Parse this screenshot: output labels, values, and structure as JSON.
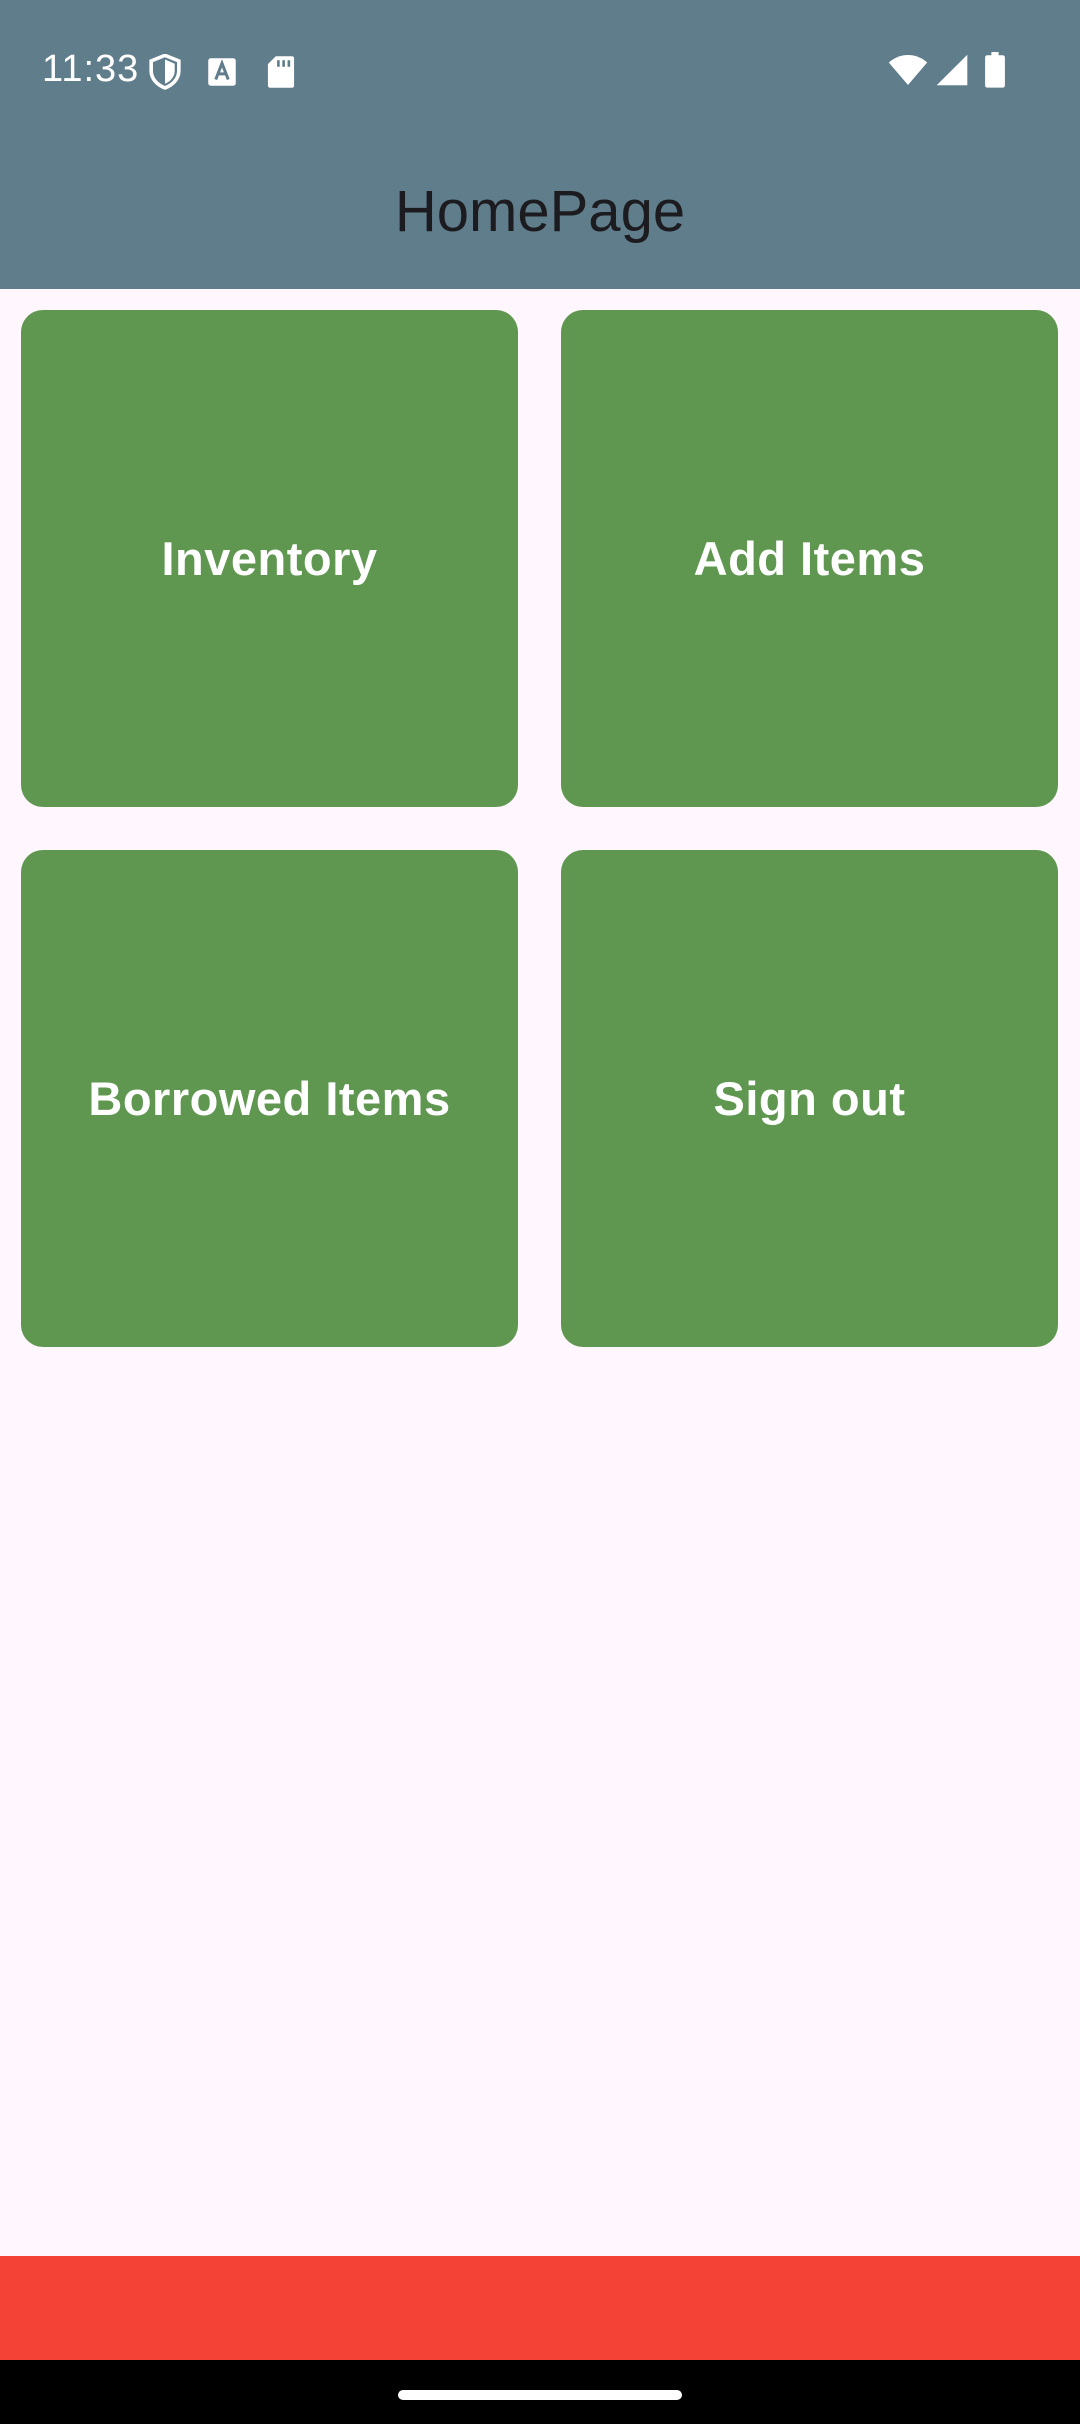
{
  "status_bar": {
    "time": "11:33",
    "left_icons": [
      "shield-icon",
      "font-a-icon",
      "sd-card-icon"
    ],
    "right_icons": [
      "wifi-icon",
      "cell-signal-icon",
      "battery-icon"
    ]
  },
  "header": {
    "title": "HomePage",
    "background": "#607D8B"
  },
  "tiles": [
    {
      "label": "Inventory"
    },
    {
      "label": "Add Items"
    },
    {
      "label": "Borrowed Items"
    },
    {
      "label": "Sign out"
    }
  ],
  "colors": {
    "tile": "#5F9751",
    "page_background": "#FFF7FD",
    "bottom_bar": "#F44336",
    "nav_bar": "#000000"
  }
}
